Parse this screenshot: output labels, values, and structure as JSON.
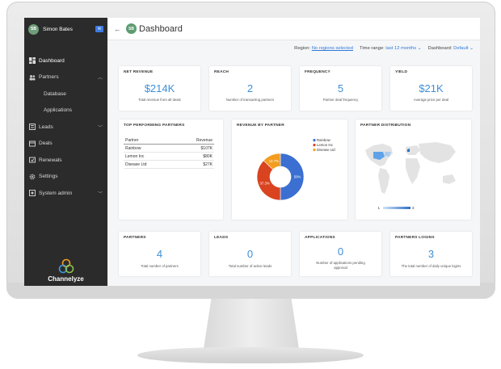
{
  "user": {
    "name": "Simon Bates",
    "initials": "SB"
  },
  "sidebar": {
    "items": [
      {
        "label": "Dashboard",
        "icon": "dashboard-icon",
        "active": true
      },
      {
        "label": "Partners",
        "icon": "people-icon",
        "expanded": true
      },
      {
        "label": "Database",
        "sub": true
      },
      {
        "label": "Applications",
        "sub": true
      },
      {
        "label": "Leads",
        "icon": "leads-icon"
      },
      {
        "label": "Deals",
        "icon": "deals-icon"
      },
      {
        "label": "Renewals",
        "icon": "renewals-icon"
      },
      {
        "label": "Settings",
        "icon": "gear-icon"
      },
      {
        "label": "System admin",
        "icon": "admin-icon"
      }
    ],
    "brand": "Channelyze"
  },
  "header": {
    "back_icon": "arrow-left-icon",
    "title": "Dashboard",
    "title_initials": "SB"
  },
  "filters": {
    "region_label": "Region:",
    "region_value": "No regions selected",
    "time_label": "Time range:",
    "time_value": "last 12 months",
    "dashboard_label": "Dashboard:",
    "dashboard_value": "Default"
  },
  "kpis_top": [
    {
      "title": "NET REVENUE",
      "value": "$214K",
      "sub": "Total revenue from all deals"
    },
    {
      "title": "REACH",
      "value": "2",
      "sub": "Number of transacting partners"
    },
    {
      "title": "FREQUENCY",
      "value": "5",
      "sub": "Partner deal frequency"
    },
    {
      "title": "YIELD",
      "value": "$21K",
      "sub": "Average price per deal"
    }
  ],
  "top_partners": {
    "title": "TOP PERFORMING PARTNERS",
    "columns": [
      "Partner",
      "Revenue"
    ],
    "rows": [
      [
        "Rainbow",
        "$107K"
      ],
      [
        "Lemon Inc",
        "$80K"
      ],
      [
        "Disease Ltd",
        "$27K"
      ]
    ]
  },
  "revenue_by_partner": {
    "title": "REVENUE BY PARTNER",
    "chart_data": {
      "type": "pie",
      "labels": [
        "Rainbow",
        "Lemon Inc",
        "Disease Ltd"
      ],
      "values": [
        50,
        37.3,
        12.7
      ],
      "value_labels": [
        "50%",
        "37.3%",
        "12.7%"
      ],
      "colors": [
        "#3b6fd1",
        "#d9431f",
        "#f29d1f"
      ],
      "legend": "right"
    }
  },
  "partner_distribution": {
    "title": "PARTNER DISTRIBUTION",
    "scale_min": "1",
    "scale_max": "3"
  },
  "kpis_bottom": [
    {
      "title": "PARTNERS",
      "value": "4",
      "sub": "Total number of partners"
    },
    {
      "title": "LEADS",
      "value": "0",
      "sub": "Total number of active leads"
    },
    {
      "title": "APPLICATIONS",
      "value": "0",
      "sub": "Number of applications pending approval"
    },
    {
      "title": "PARTNERS LOGINS",
      "value": "3",
      "sub": "The total number of daily unique logins"
    }
  ]
}
